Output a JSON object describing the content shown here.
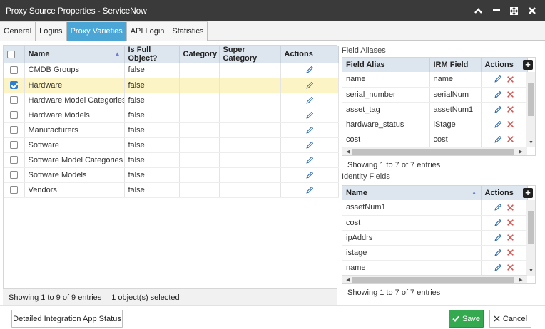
{
  "window": {
    "title": "Proxy Source Properties - ServiceNow",
    "controls": [
      "chevron-up-icon",
      "minimize-icon",
      "expand-icon",
      "close-icon"
    ]
  },
  "tabs": [
    {
      "label": "General",
      "active": false
    },
    {
      "label": "Logins",
      "active": false
    },
    {
      "label": "Proxy Varieties",
      "active": true
    },
    {
      "label": "API Login",
      "active": false
    },
    {
      "label": "Statistics",
      "active": false
    }
  ],
  "varieties": {
    "columns": [
      "Name",
      "Is Full Object?",
      "Category",
      "Super Category",
      "Actions"
    ],
    "rows": [
      {
        "name": "CMDB Groups",
        "full": "false",
        "category": "",
        "super": "",
        "checked": false
      },
      {
        "name": "Hardware",
        "full": "false",
        "category": "",
        "super": "",
        "checked": true
      },
      {
        "name": "Hardware Model Categories",
        "full": "false",
        "category": "",
        "super": "",
        "checked": false
      },
      {
        "name": "Hardware Models",
        "full": "false",
        "category": "",
        "super": "",
        "checked": false
      },
      {
        "name": "Manufacturers",
        "full": "false",
        "category": "",
        "super": "",
        "checked": false
      },
      {
        "name": "Software",
        "full": "false",
        "category": "",
        "super": "",
        "checked": false
      },
      {
        "name": "Software Model Categories",
        "full": "false",
        "category": "",
        "super": "",
        "checked": false
      },
      {
        "name": "Software Models",
        "full": "false",
        "category": "",
        "super": "",
        "checked": false
      },
      {
        "name": "Vendors",
        "full": "false",
        "category": "",
        "super": "",
        "checked": false
      }
    ],
    "footer_showing": "Showing 1 to 9 of 9 entries",
    "footer_selected": "1 object(s) selected"
  },
  "field_aliases": {
    "label": "Field Aliases",
    "columns": [
      "Field Alias",
      "IRM Field",
      "Actions"
    ],
    "rows": [
      {
        "alias": "name",
        "irm": "name"
      },
      {
        "alias": "serial_number",
        "irm": "serialNum"
      },
      {
        "alias": "asset_tag",
        "irm": "assetNum1"
      },
      {
        "alias": "hardware_status",
        "irm": "iStage"
      },
      {
        "alias": "cost",
        "irm": "cost"
      }
    ],
    "info": "Showing 1 to 7 of 7 entries"
  },
  "identity_fields": {
    "label": "Identity Fields",
    "columns": [
      "Name",
      "Actions"
    ],
    "rows": [
      {
        "name": "assetNum1"
      },
      {
        "name": "cost"
      },
      {
        "name": "ipAddrs"
      },
      {
        "name": "istage"
      },
      {
        "name": "name"
      }
    ],
    "info": "Showing 1 to 7 of 7 entries"
  },
  "buttons": {
    "status": "Detailed Integration App Status",
    "save": "Save",
    "cancel": "Cancel"
  },
  "colors": {
    "titlebar": "#3a3a3a",
    "active_tab": "#4ba6d6",
    "header_bg": "#dde5ef",
    "selected_row": "#fcf4c4",
    "save_green": "#35a94f",
    "delete_red": "#d9534f",
    "edit_blue": "#2f6db5"
  }
}
